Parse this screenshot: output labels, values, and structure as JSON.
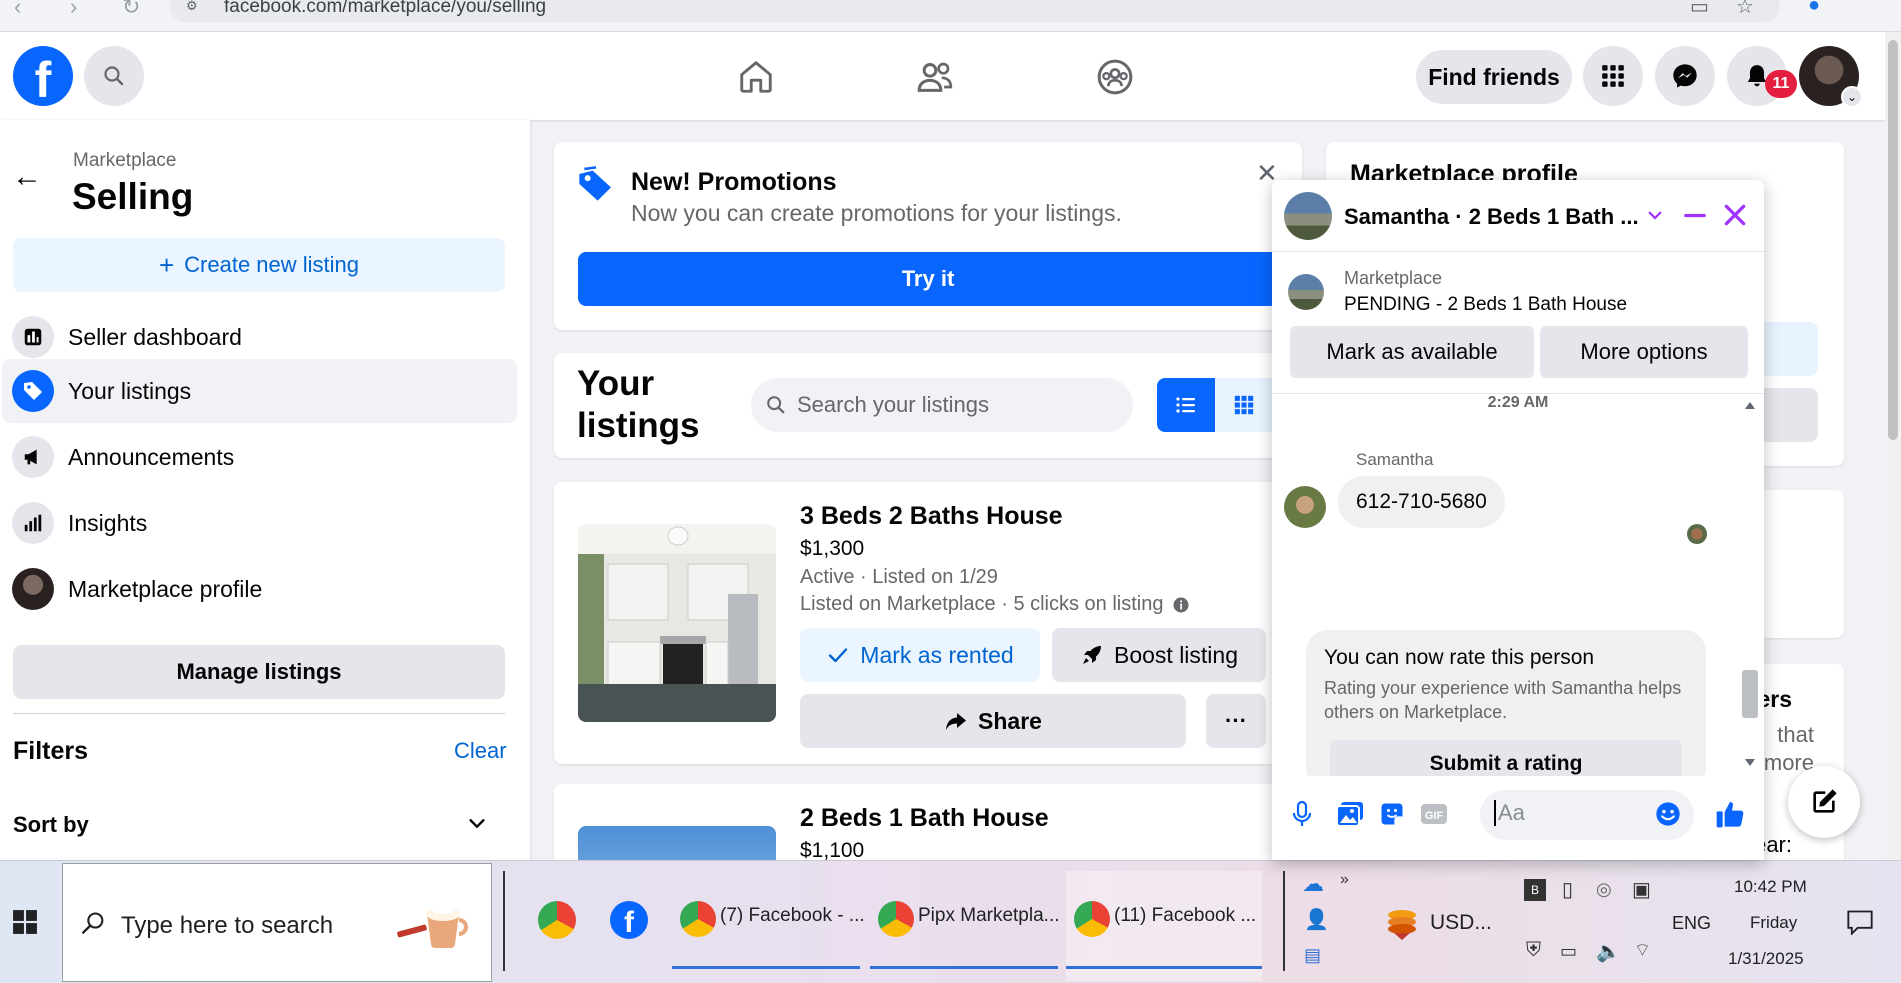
{
  "browser": {
    "url": "facebook.com/marketplace/you/selling"
  },
  "topnav": {
    "logo": "f",
    "find_friends": "Find friends",
    "notifications_count": "11"
  },
  "sidebar": {
    "subtitle": "Marketplace",
    "title": "Selling",
    "create_listing": "Create new listing",
    "items": [
      {
        "label": "Seller dashboard",
        "icon": "dashboard-icon"
      },
      {
        "label": "Your listings",
        "icon": "tag-icon",
        "active": true
      },
      {
        "label": "Announcements",
        "icon": "megaphone-icon"
      },
      {
        "label": "Insights",
        "icon": "bar-chart-icon"
      },
      {
        "label": "Marketplace profile",
        "icon": "profile-avatar"
      }
    ],
    "manage_listings": "Manage listings",
    "filters": "Filters",
    "clear": "Clear",
    "sort_by": "Sort by"
  },
  "promo": {
    "title": "New! Promotions",
    "description": "Now you can create promotions for your listings.",
    "button": "Try it"
  },
  "your_listings": {
    "title_line1": "Your",
    "title_line2": "listings",
    "search_placeholder": "Search your listings"
  },
  "listings": [
    {
      "title": "3 Beds 2 Baths House",
      "price": "$1,300",
      "status": "Active · Listed on 1/29",
      "stats": "Listed on Marketplace · 5 clicks on listing",
      "mark_button": "Mark as rented",
      "boost_button": "Boost listing",
      "share_button": "Share",
      "more_button": "···"
    },
    {
      "title": "2 Beds 1 Bath House",
      "price": "$1,100"
    }
  ],
  "right_column": {
    "profile_title": "Marketplace profile",
    "buyers_partial": "uyers",
    "line1": "that",
    "line2": "more",
    "line3": "ear:"
  },
  "chat": {
    "header_name": "Samantha · 2 Beds 1 Bath ...",
    "marketplace_label": "Marketplace",
    "listing_status": "PENDING - 2 Beds 1 Bath House",
    "mark_available": "Mark as available",
    "more_options": "More options",
    "timestamp": "2:29 AM",
    "sender": "Samantha",
    "message": "612-710-5680",
    "rate_title": "You can now rate this person",
    "rate_desc": "Rating your experience with Samantha helps others on Marketplace.",
    "rate_button": "Submit a rating",
    "input_placeholder": "Aa",
    "accent_color": "#a033ff"
  },
  "taskbar": {
    "search_placeholder": "Type here to search",
    "tasks": [
      {
        "label": "(7) Facebook - ..."
      },
      {
        "label": "Pipx Marketpla..."
      },
      {
        "label": "(11) Facebook ..."
      }
    ],
    "weather": "USD...",
    "language": "ENG",
    "time": "10:42 PM",
    "day": "Friday",
    "date": "1/31/2025"
  }
}
